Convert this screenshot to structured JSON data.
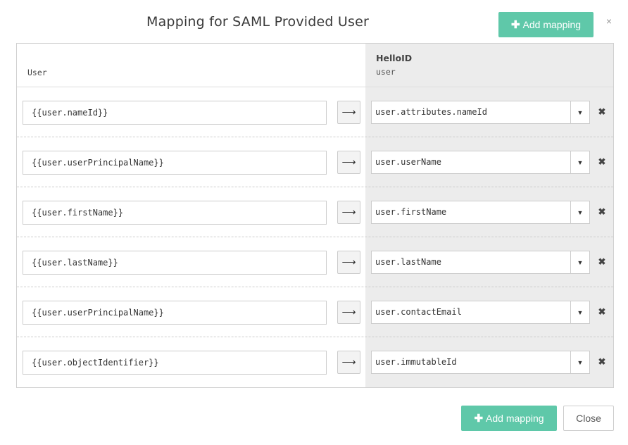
{
  "dialog": {
    "title": "Mapping for SAML Provided User",
    "close_glyph": "×",
    "add_mapping_label": "Add mapping",
    "add_icon": "plus-icon",
    "close_label": "Close"
  },
  "table": {
    "left_header": "User",
    "right_header_title": "HelloID",
    "right_header_sub": "user",
    "arrow_icon": "arrow-right-icon",
    "caret_icon": "caret-down-icon",
    "remove_icon": "remove-icon"
  },
  "rows": [
    {
      "source": "{{user.nameId}}",
      "target": "user.attributes.nameId"
    },
    {
      "source": "{{user.userPrincipalName}}",
      "target": "user.userName"
    },
    {
      "source": "{{user.firstName}}",
      "target": "user.firstName"
    },
    {
      "source": "{{user.lastName}}",
      "target": "user.lastName"
    },
    {
      "source": "{{user.userPrincipalName}}",
      "target": "user.contactEmail"
    },
    {
      "source": "{{user.objectIdentifier}}",
      "target": "user.immutableId"
    }
  ],
  "colors": {
    "accent": "#5fc8a9",
    "right_column_bg": "#ececec",
    "border": "#cccccc"
  }
}
